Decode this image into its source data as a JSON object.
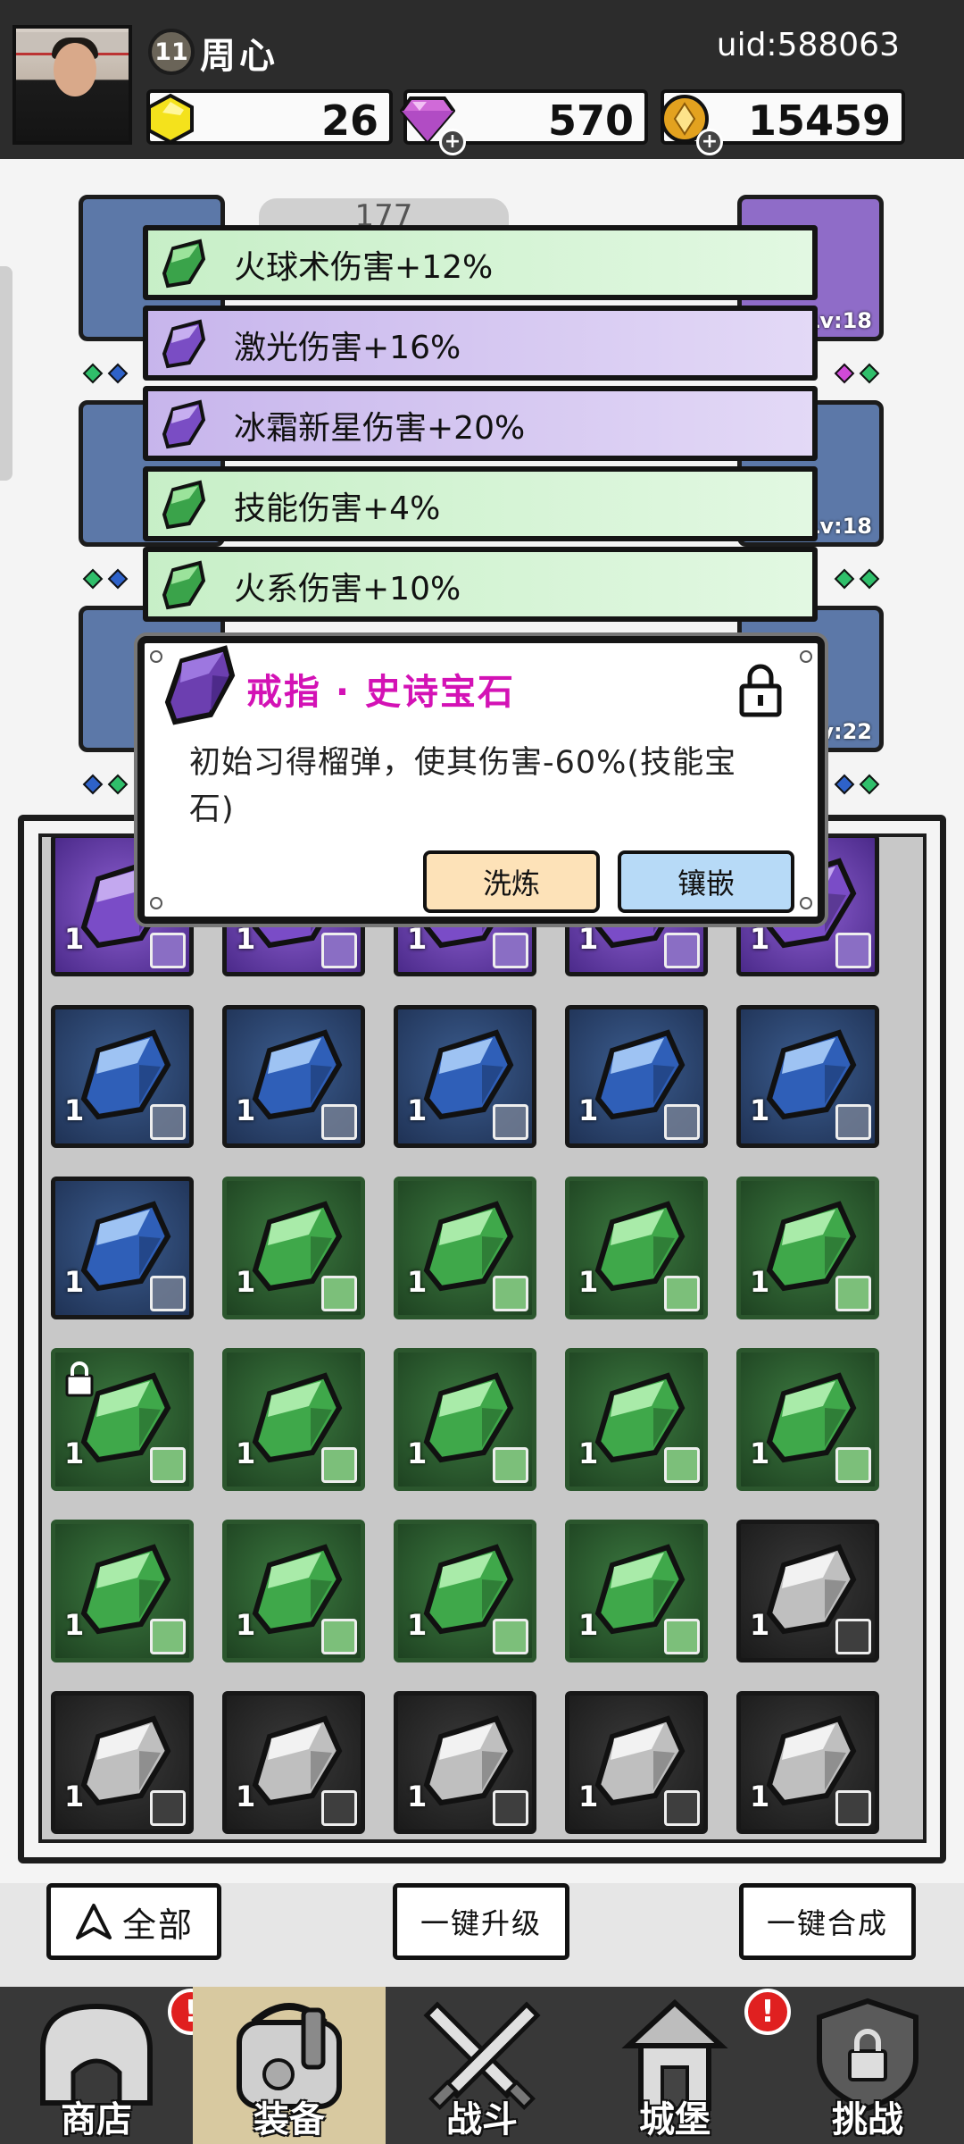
{
  "header": {
    "player_level": "11",
    "player_name": "周心",
    "uid": "uid:588063",
    "currencies": {
      "energy": "26",
      "gems": "570",
      "gold": "15459"
    }
  },
  "slots": {
    "lv_top_right": "Lv:18",
    "lv_mid_right": "Lv:18",
    "lv_low_right": "Lv:22",
    "power_partial": "177"
  },
  "skills": [
    {
      "text": "火球术伤害+12%",
      "color": "green"
    },
    {
      "text": "激光伤害+16%",
      "color": "purple"
    },
    {
      "text": "冰霜新星伤害+20%",
      "color": "purple"
    },
    {
      "text": "技能伤害+4%",
      "color": "green"
    },
    {
      "text": "火系伤害+10%",
      "color": "green"
    }
  ],
  "popup": {
    "title": "戒指 · 史诗宝石",
    "description": "初始习得榴弹，使其伤害-60%(技能宝石)",
    "refine_label": "洗炼",
    "inlay_label": "镶嵌",
    "locked": true
  },
  "inventory": {
    "count_label": "1",
    "rows": [
      [
        "purple",
        "purple",
        "purple",
        "purple",
        "purple"
      ],
      [
        "blue",
        "blue",
        "blue",
        "blue",
        "blue"
      ],
      [
        "blue",
        "green",
        "green",
        "green",
        "green"
      ],
      [
        "green",
        "green",
        "green",
        "green",
        "green"
      ],
      [
        "green",
        "green",
        "green",
        "green",
        "gray"
      ],
      [
        "gray",
        "gray",
        "gray",
        "gray",
        "gray"
      ]
    ]
  },
  "actions": {
    "all_label": "全部",
    "upgrade_label": "一键升级",
    "compose_label": "一键合成"
  },
  "nav": {
    "shop": "商店",
    "equip": "装备",
    "battle": "战斗",
    "castle": "城堡",
    "challenge": "挑战",
    "alert": "!"
  },
  "colors": {
    "epic": "#d312b5",
    "refine_btn": "#fde2b8",
    "inlay_btn": "#b7daf7"
  }
}
